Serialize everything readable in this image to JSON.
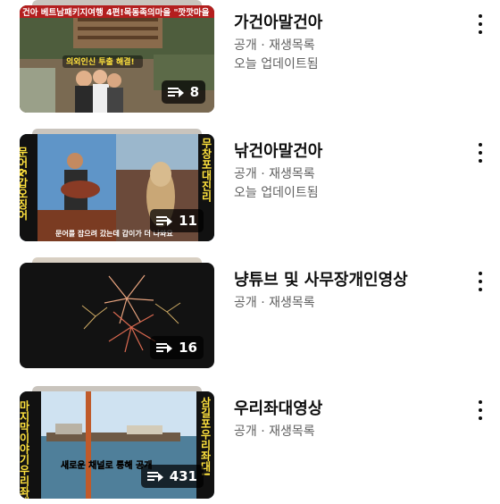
{
  "playlists": [
    {
      "title": "가건아말건아",
      "visibility": "공개 · 재생목록",
      "updated": "오늘 업데이트됨",
      "count": "8",
      "thumb_caption_top": "건아 베트남패키지여행 4편!목동족의마을 \"깟깟마을",
      "thumb_caption_mid": "의외인신 투출 해결!"
    },
    {
      "title": "낚건아말건아",
      "visibility": "공개 · 재생목록",
      "updated": "오늘 업데이트됨",
      "count": "11",
      "thumb_side_left": "문어&갑오징어",
      "thumb_side_right": "무창포대진리",
      "thumb_caption_bottom": "문어를 잡으려 갔는데 갑이가 더 나와요"
    },
    {
      "title": "냥튜브 및 사무장개인영상",
      "visibility": "공개 · 재생목록",
      "count": "16"
    },
    {
      "title": "우리좌대영상",
      "visibility": "공개 · 재생목록",
      "count": "431",
      "thumb_side_left": "마지막이야기우리좌대",
      "thumb_side_right": "삼길포우리좌대!",
      "thumb_caption_bottom": "새로운 채널로 통해 공개"
    }
  ],
  "icons": {
    "playlist": "playlist-icon",
    "more": "more-vert-icon"
  }
}
